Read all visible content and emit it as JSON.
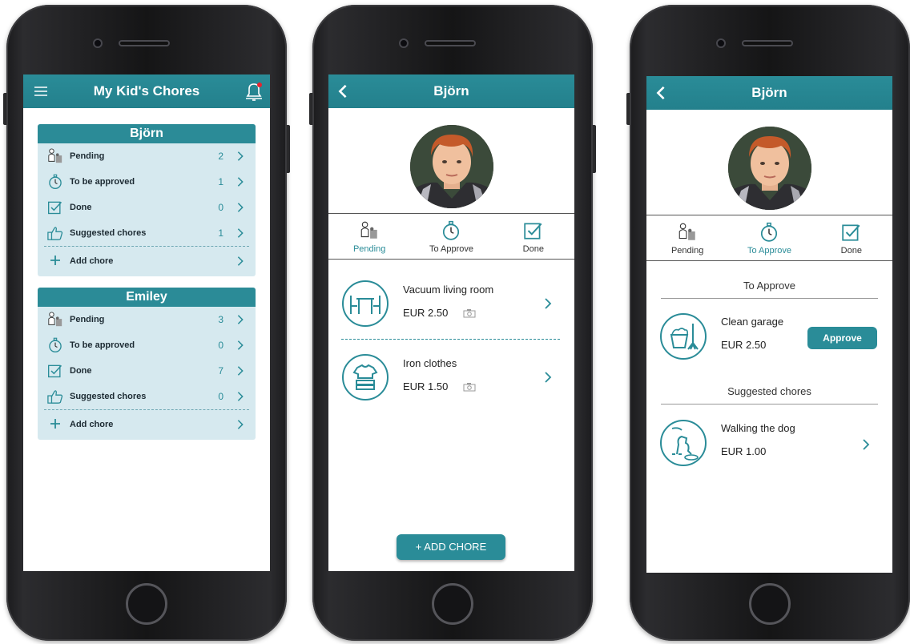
{
  "colors": {
    "accent": "#2a8c98",
    "card": "#d6e9ef",
    "phone": "#1b1b1d"
  },
  "screen1": {
    "title": "My Kid's Chores",
    "menu_icon": "hamburger-menu-icon",
    "bell_icon": "notification-bell-icon",
    "kids": [
      {
        "name": "Björn",
        "rows": [
          {
            "icon": "pending-icon",
            "label": "Pending",
            "count": "2"
          },
          {
            "icon": "stopwatch-icon",
            "label": "To be approved",
            "count": "1"
          },
          {
            "icon": "checkbox-icon",
            "label": "Done",
            "count": "0"
          },
          {
            "icon": "thumbs-up-icon",
            "label": "Suggested chores",
            "count": "1"
          }
        ],
        "add_label": "Add chore"
      },
      {
        "name": "Emiley",
        "rows": [
          {
            "icon": "pending-icon",
            "label": "Pending",
            "count": "3"
          },
          {
            "icon": "stopwatch-icon",
            "label": "To be approved",
            "count": "0"
          },
          {
            "icon": "checkbox-icon",
            "label": "Done",
            "count": "7"
          },
          {
            "icon": "thumbs-up-icon",
            "label": "Suggested chores",
            "count": "0"
          }
        ],
        "add_label": "Add chore"
      }
    ]
  },
  "screen2": {
    "title": "Björn",
    "tabs": [
      "Pending",
      "To Approve",
      "Done"
    ],
    "chores": [
      {
        "name": "Vacuum living room",
        "price": "EUR 2.50",
        "icon": "table-chairs-icon"
      },
      {
        "name": "Iron clothes",
        "price": "EUR 1.50",
        "icon": "folded-clothes-icon"
      }
    ],
    "add_button": "+ ADD CHORE"
  },
  "screen3": {
    "title": "Björn",
    "tabs": [
      "Pending",
      "To Approve",
      "Done"
    ],
    "section_approve": "To Approve",
    "approve_item": {
      "name": "Clean garage",
      "price": "EUR 2.50",
      "button": "Approve",
      "icon": "bucket-broom-icon"
    },
    "section_suggested": "Suggested chores",
    "suggested_item": {
      "name": "Walking the dog",
      "price": "EUR 1.00",
      "icon": "dog-icon"
    }
  }
}
